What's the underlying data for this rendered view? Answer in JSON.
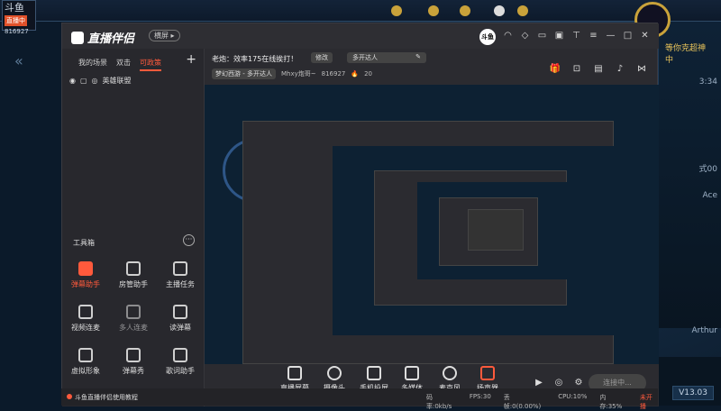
{
  "background": {
    "logo_text": "斗鱼",
    "logo_badge": "直播中",
    "logo_id": "816927",
    "right_title": "等你克超神",
    "right_sub": "中",
    "right_time": "3:34",
    "right_lines": [
      "式00",
      "Ace",
      "Arthur"
    ],
    "version": "V13.03"
  },
  "app": {
    "brand": "直播伴侣",
    "mode_label": "横屏",
    "titlebar_icons": [
      "headset-icon",
      "skin-icon",
      "message-icon",
      "gift-icon",
      "shirt-icon",
      "menu-icon",
      "minimize-icon",
      "maximize-icon",
      "close-icon"
    ],
    "avatar_text": "斗鱼"
  },
  "sidebar": {
    "tabs": [
      "我的场景",
      "双击",
      "可政策"
    ],
    "active_tab": 2,
    "scene_label": "英雄联盟",
    "tools_title": "工具箱",
    "tools": [
      {
        "label": "弹幕助手",
        "icon": "danmu-icon",
        "hot": true
      },
      {
        "label": "房管助手",
        "icon": "room-admin-icon",
        "hot": false
      },
      {
        "label": "主播任务",
        "icon": "task-icon",
        "hot": false
      },
      {
        "label": "视频连麦",
        "icon": "video-call-icon",
        "hot": false
      },
      {
        "label": "多人连麦",
        "icon": "multi-call-icon",
        "hot": false
      },
      {
        "label": "读弹幕",
        "icon": "read-danmu-icon",
        "hot": false
      },
      {
        "label": "虚拟形象",
        "icon": "avatar-icon",
        "hot": false
      },
      {
        "label": "弹幕秀",
        "icon": "danmu-show-icon",
        "hot": false
      },
      {
        "label": "歌词助手",
        "icon": "lyrics-icon",
        "hot": false
      }
    ],
    "footer": "斗鱼直播伴侣使用教程"
  },
  "header": {
    "room_title": "老炮：效率175在线挨打！",
    "edit_label": "修改",
    "tag_value": "多开达人",
    "category": "梦幻西游 - 多开达人",
    "nickname": "Mhxy炮哥~",
    "room_id": "816927",
    "fans": "20"
  },
  "bottom_toolbar": {
    "items": [
      "直播屏幕",
      "摄像头",
      "手机投屏",
      "多媒体",
      "麦克风",
      "扬声器"
    ],
    "live_button": "连接中..."
  },
  "status_bar": {
    "bitrate": "码率:0kb/s",
    "fps": "FPS:30",
    "dropped": "丢帧:0(0.00%)",
    "cpu": "CPU:10%",
    "memory": "内存:35%",
    "state": "未开播"
  }
}
